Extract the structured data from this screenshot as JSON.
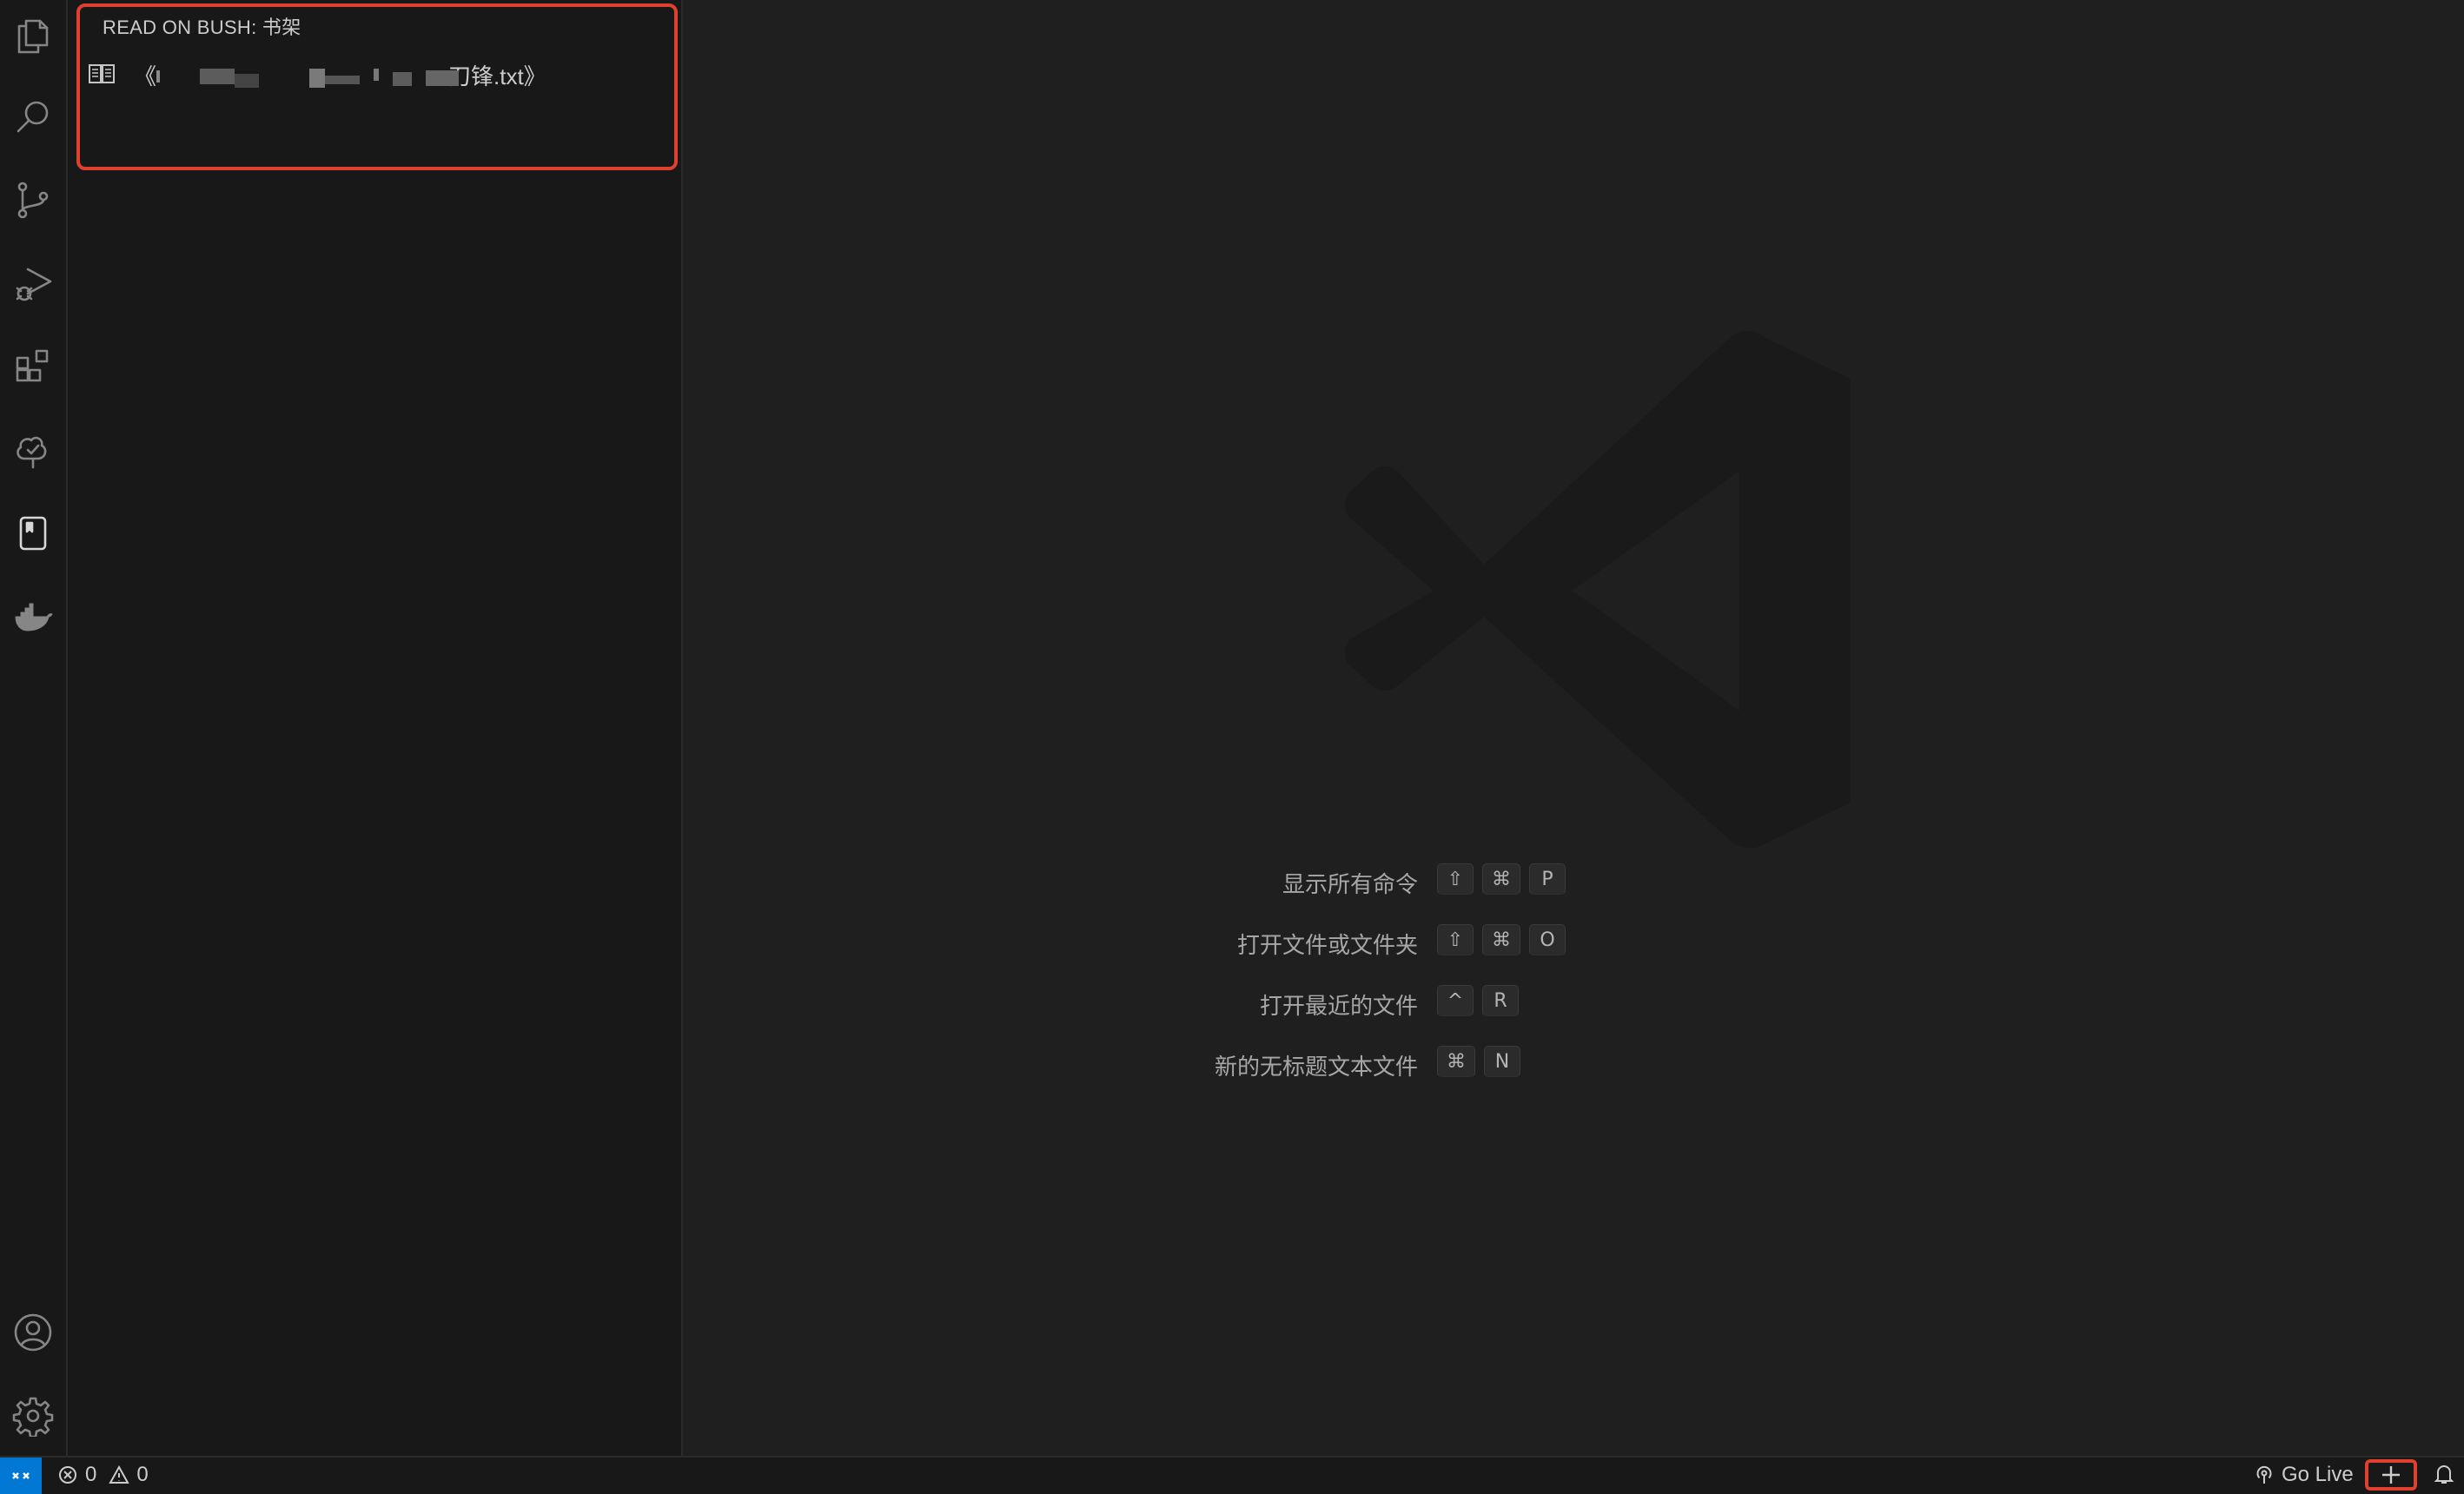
{
  "activity_bar": {
    "items": [
      {
        "name": "explorer",
        "icon": "files-icon"
      },
      {
        "name": "search",
        "icon": "search-icon"
      },
      {
        "name": "source-control",
        "icon": "source-control-icon"
      },
      {
        "name": "run-debug",
        "icon": "run-debug-icon"
      },
      {
        "name": "extensions",
        "icon": "extensions-icon"
      },
      {
        "name": "testing",
        "icon": "tree-check-icon"
      },
      {
        "name": "read-on-bush",
        "icon": "book-icon",
        "active": true
      },
      {
        "name": "docker",
        "icon": "docker-whale-icon"
      }
    ],
    "bottom": [
      {
        "name": "accounts",
        "icon": "account-icon"
      },
      {
        "name": "manage",
        "icon": "gear-icon"
      }
    ]
  },
  "sidebar": {
    "title": "READ ON BUSH: 书架",
    "books": [
      {
        "prefix": "《",
        "suffix": "刀锋.txt》",
        "icon": "book-open-icon"
      }
    ]
  },
  "editor": {
    "watermark_icon": "vscode-logo-icon",
    "shortcuts": [
      {
        "label": "显示所有命令",
        "keys": [
          "⇧",
          "⌘",
          "P"
        ]
      },
      {
        "label": "打开文件或文件夹",
        "keys": [
          "⇧",
          "⌘",
          "O"
        ]
      },
      {
        "label": "打开最近的文件",
        "keys": [
          "^",
          "R"
        ]
      },
      {
        "label": "新的无标题文本文件",
        "keys": [
          "⌘",
          "N"
        ]
      }
    ]
  },
  "status_bar": {
    "errors": "0",
    "warnings": "0",
    "go_live": "Go Live"
  },
  "colors": {
    "highlight": "#e0412e",
    "remote": "#0078d4"
  }
}
